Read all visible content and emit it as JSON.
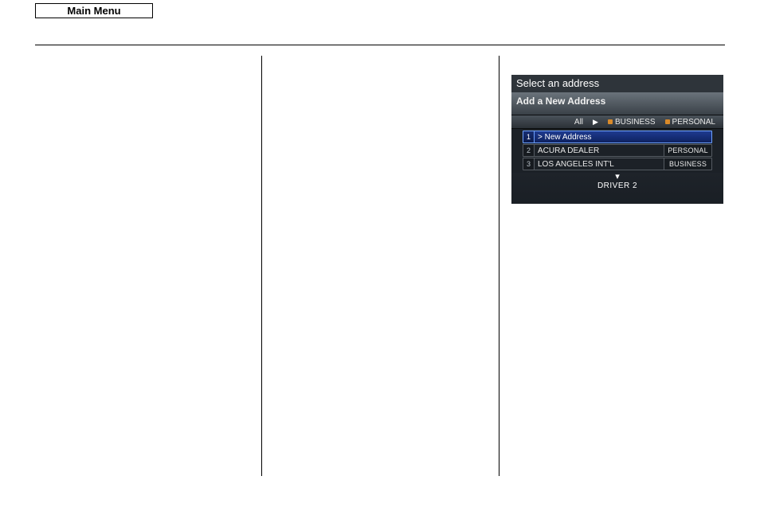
{
  "header": {
    "main_menu_label": "Main Menu"
  },
  "nav_screen": {
    "title": "Select an address",
    "subtitle": "Add a New Address",
    "filters": {
      "all": "All",
      "business": "BUSINESS",
      "personal": "PERSONAL"
    },
    "rows": [
      {
        "num": "1",
        "label": "> New Address",
        "tag": "",
        "selected": true
      },
      {
        "num": "2",
        "label": "ACURA DEALER",
        "tag": "PERSONAL",
        "selected": false
      },
      {
        "num": "3",
        "label": "LOS ANGELES INT'L",
        "tag": "BUSINESS",
        "selected": false
      }
    ],
    "driver_label": "DRIVER 2"
  }
}
